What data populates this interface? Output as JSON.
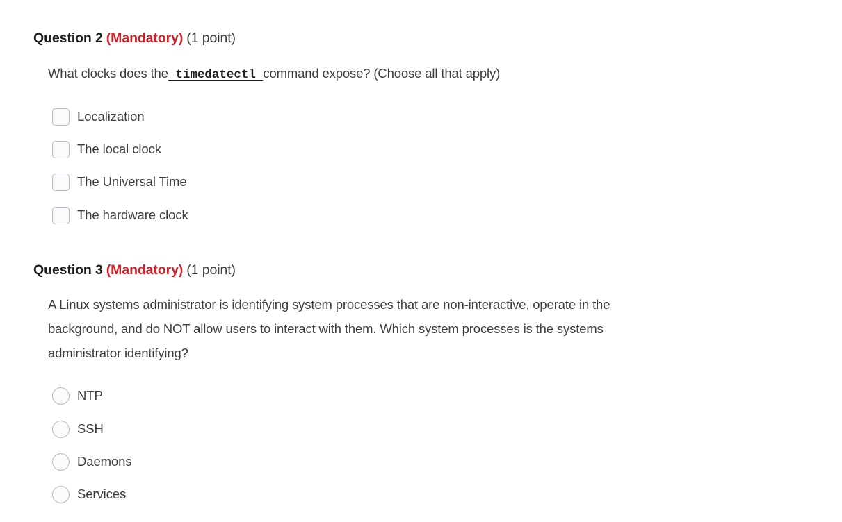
{
  "questions": [
    {
      "number_label": "Question 2",
      "mandatory_label": "(Mandatory)",
      "points_label": "(1 point)",
      "prompt_before": "What clocks does the",
      "prompt_code": " timedatectl ",
      "prompt_after": "command expose? (Choose all that apply)",
      "input_type": "checkbox",
      "options": [
        {
          "label": "Localization",
          "checked": false
        },
        {
          "label": "The local clock",
          "checked": false
        },
        {
          "label": "The Universal Time",
          "checked": false
        },
        {
          "label": "The hardware clock",
          "checked": false
        }
      ]
    },
    {
      "number_label": "Question 3",
      "mandatory_label": "(Mandatory)",
      "points_label": "(1 point)",
      "prompt": "A Linux systems administrator is identifying system processes that are non-interactive, operate in the background, and do NOT allow users to interact with them. Which system processes is the systems administrator identifying?",
      "input_type": "radio",
      "options": [
        {
          "label": "NTP",
          "checked": false
        },
        {
          "label": "SSH",
          "checked": false
        },
        {
          "label": "Daemons",
          "checked": false
        },
        {
          "label": "Services",
          "checked": false
        }
      ]
    }
  ],
  "colors": {
    "mandatory_red": "#cc2027",
    "heading_text": "#1f1f1f",
    "body_text": "#3c3c3c",
    "control_border": "#b8b8bd",
    "control_fill": "#fbfbfd",
    "page_background": "#ffffff"
  }
}
